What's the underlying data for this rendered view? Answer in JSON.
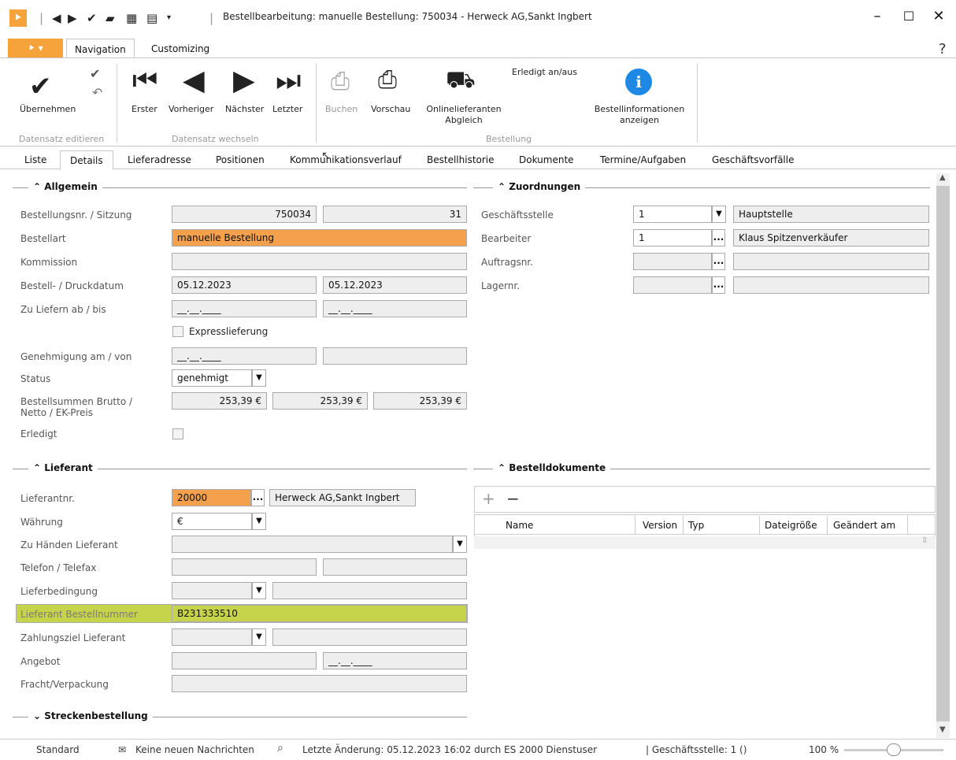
{
  "window": {
    "title": "Bestellbearbeitung: manuelle Bestellung: 750034 - Herweck AG,Sankt Ingbert",
    "minimize": "–",
    "maximize": "☐",
    "close": "✕",
    "help": "?"
  },
  "ribbon_tabs": [
    "Navigation",
    "Customizing"
  ],
  "ribbon": {
    "groups": {
      "edit": "Datensatz editieren",
      "switch": "Datensatz wechseln",
      "order": "Bestellung"
    },
    "buttons": {
      "apply": "Übernehmen",
      "first": "Erster",
      "prev": "Vorheriger",
      "next": "Nächster",
      "last": "Letzter",
      "book": "Buchen",
      "preview": "Vorschau",
      "online": "Onlinelieferanten",
      "online2": "Abgleich",
      "done_toggle": "Erledigt an/aus",
      "info": "Bestellinformationen",
      "info2": "anzeigen"
    }
  },
  "tabs": [
    "Liste",
    "Details",
    "Lieferadresse",
    "Positionen",
    "Kommunikationsverlauf",
    "Bestellhistorie",
    "Dokumente",
    "Termine/Aufgaben",
    "Geschäftsvorfälle"
  ],
  "sections": {
    "general": "Allgemein",
    "assign": "Zuordnungen",
    "supplier": "Lieferant",
    "docs": "Bestelldokumente",
    "route": "Streckenbestellung"
  },
  "general": {
    "order_no_label": "Bestellungsnr. / Sitzung",
    "order_no": "750034",
    "session": "31",
    "type_label": "Bestellart",
    "type": "manuelle Bestellung",
    "commission_label": "Kommission",
    "commission": "",
    "date_label": "Bestell- / Druckdatum",
    "order_date": "05.12.2023",
    "print_date": "05.12.2023",
    "deliver_label": "Zu Liefern ab / bis",
    "deliver_from": "__.__.____",
    "deliver_to": "__.__.____",
    "express_label": "Expresslieferung",
    "approval_label": "Genehmigung am / von",
    "approval_date": "__.__.____",
    "approval_by": "",
    "status_label": "Status",
    "status": "genehmigt",
    "sums_label1": "Bestellsummen Brutto /",
    "sums_label2": "Netto / EK-Preis",
    "sum_gross": "253,39 €",
    "sum_net": "253,39 €",
    "sum_ek": "253,39 €",
    "done_label": "Erledigt"
  },
  "assign": {
    "branch_label": "Geschäftsstelle",
    "branch_no": "1",
    "branch_name": "Hauptstelle",
    "clerk_label": "Bearbeiter",
    "clerk_no": "1",
    "clerk_name": "Klaus Spitzenverkäufer",
    "job_label": "Auftragsnr.",
    "store_label": "Lagernr."
  },
  "supplier": {
    "no_label": "Lieferantnr.",
    "no": "20000",
    "name": "Herweck AG,Sankt Ingbert",
    "currency_label": "Währung",
    "currency": "€",
    "attn_label": "Zu Händen Lieferant",
    "phone_label": "Telefon / Telefax",
    "terms_label": "Lieferbedingung",
    "order_no_label": "Lieferant Bestellnummer",
    "order_no": "B231333510",
    "payment_label": "Zahlungsziel Lieferant",
    "offer_label": "Angebot",
    "offer_date": "__.__.____",
    "freight_label": "Fracht/Verpackung"
  },
  "docs": {
    "add": "+",
    "remove": "−",
    "columns": [
      "Name",
      "Version",
      "Typ",
      "Dateigröße",
      "Geändert am"
    ]
  },
  "status": {
    "profile": "Standard",
    "messages": "Keine neuen Nachrichten",
    "last_change": "Letzte Änderung: 05.12.2023 16:02 durch ES 2000 Dienstuser",
    "branch": "| Geschäftsstelle: 1 ()",
    "zoom": "100 %"
  }
}
